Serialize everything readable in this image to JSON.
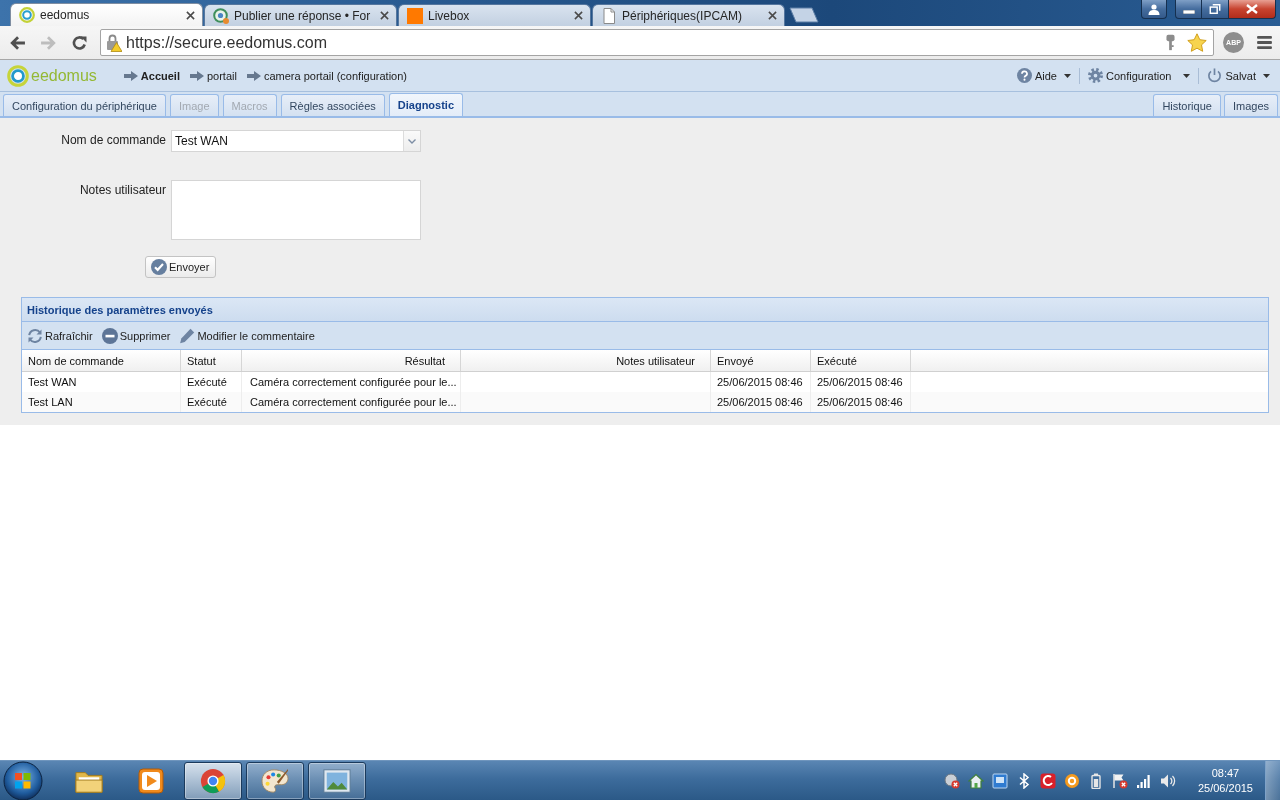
{
  "browser": {
    "tabs": [
      {
        "title": "eedomus",
        "selected": true
      },
      {
        "title": "Publier une réponse • For",
        "selected": false
      },
      {
        "title": "Livebox",
        "selected": false
      },
      {
        "title": "Périphériques(IPCAM)",
        "selected": false
      }
    ],
    "nav_buttons": [
      {
        "kind": "back",
        "disabled": false
      },
      {
        "kind": "forward",
        "disabled": true
      },
      {
        "kind": "reload",
        "disabled": false
      }
    ],
    "url": "https://secure.eedomus.com",
    "extension_badge": "ABP"
  },
  "app": {
    "logo": "eedomus",
    "breadcrumbs": [
      {
        "label": "Accueil",
        "emphasized": true
      },
      {
        "label": "portail",
        "emphasized": false
      },
      {
        "label": "camera portail (configuration)",
        "emphasized": false
      }
    ],
    "menus": [
      "Aide",
      "Configuration",
      "Salvat"
    ]
  },
  "tabs": [
    {
      "label": "Configuration du périphérique",
      "selected": false,
      "disabled": false
    },
    {
      "label": "Image",
      "selected": false,
      "disabled": true
    },
    {
      "label": "Macros",
      "selected": false,
      "disabled": true
    },
    {
      "label": "Règles associées",
      "selected": false,
      "disabled": false
    },
    {
      "label": "Diagnostic",
      "selected": true,
      "disabled": false
    }
  ],
  "side_tabs": [
    {
      "label": "Historique",
      "selected": false,
      "disabled": false
    },
    {
      "label": "Images",
      "selected": false,
      "disabled": false
    }
  ],
  "form": {
    "fields": [
      {
        "label": "Nom de commande",
        "kind": "select",
        "value": "Test WAN"
      },
      {
        "label": "Notes utilisateur",
        "kind": "textarea"
      }
    ],
    "submit": "Envoyer"
  },
  "history": {
    "title": "Historique des paramètres envoyés",
    "actions": [
      "Rafraîchir",
      "Supprimer",
      "Modifier le commentaire"
    ],
    "columns": [
      "Nom de commande",
      "Statut",
      "Résultat",
      "Notes utilisateur",
      "Envoyé",
      "Exécuté"
    ],
    "rows": [
      {
        "name": "Test WAN",
        "status": "Exécuté",
        "result": "Caméra correctement configurée pour le...",
        "sent": "25/06/2015 08:46",
        "executed": "25/06/2015 08:46"
      },
      {
        "name": "Test LAN",
        "status": "Exécuté",
        "result": "Caméra correctement configurée pour le...",
        "sent": "25/06/2015 08:46",
        "executed": "25/06/2015 08:46"
      }
    ]
  },
  "taskbar": {
    "apps": [
      {
        "running": false,
        "selected": false
      },
      {
        "running": false,
        "selected": false
      },
      {
        "running": true,
        "selected": true
      },
      {
        "running": true,
        "selected": false
      },
      {
        "running": true,
        "selected": false
      }
    ],
    "clock": {
      "time": "08:47",
      "date": "25/06/2015"
    }
  }
}
